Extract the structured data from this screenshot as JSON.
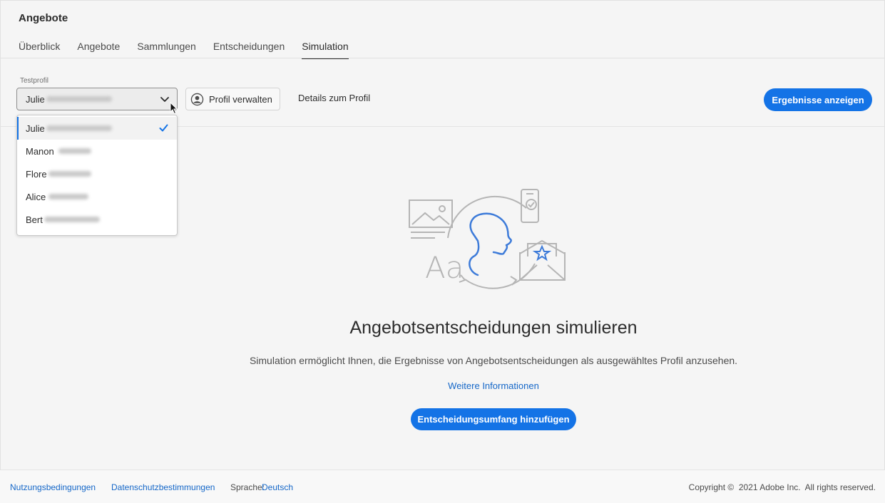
{
  "app": {
    "title": "Angebote"
  },
  "tabs": [
    {
      "label": "Überblick",
      "active": false
    },
    {
      "label": "Angebote",
      "active": false
    },
    {
      "label": "Sammlungen",
      "active": false
    },
    {
      "label": "Entscheidungen",
      "active": false
    },
    {
      "label": "Simulation",
      "active": true
    }
  ],
  "toolbar": {
    "profile_label": "Testprofil",
    "selected_profile": "Julie",
    "manage_button": "Profil verwalten",
    "details_link": "Details zum Profil",
    "results_button": "Ergebnisse anzeigen"
  },
  "dropdown": {
    "items": [
      {
        "label": "Julie",
        "selected": true
      },
      {
        "label": "Manon",
        "selected": false
      },
      {
        "label": "Flore",
        "selected": false
      },
      {
        "label": "Alice",
        "selected": false
      },
      {
        "label": "Bert",
        "selected": false
      }
    ]
  },
  "empty_state": {
    "title": "Angebotsentscheidungen simulieren",
    "description": "Simulation ermöglicht Ihnen, die Ergebnisse von Angebotsentscheidungen als ausgewähltes Profil anzusehen.",
    "learn_more": "Weitere Informationen",
    "cta": "Entscheidungsumfang hinzufügen",
    "illustration_text": "Aa"
  },
  "footer": {
    "terms": "Nutzungsbedingungen",
    "privacy": "Datenschutzbestimmungen",
    "language_label": "Sprache:",
    "language_value": "Deutsch",
    "copyright": "Copyright ©  2021 Adobe Inc.  All rights reserved."
  },
  "colors": {
    "accent": "#1473e6",
    "link": "#1567c8",
    "background": "#f5f5f5"
  },
  "icons": [
    "chevron-down-icon",
    "user-icon",
    "checkmark-icon",
    "mouse-pointer-icon"
  ]
}
